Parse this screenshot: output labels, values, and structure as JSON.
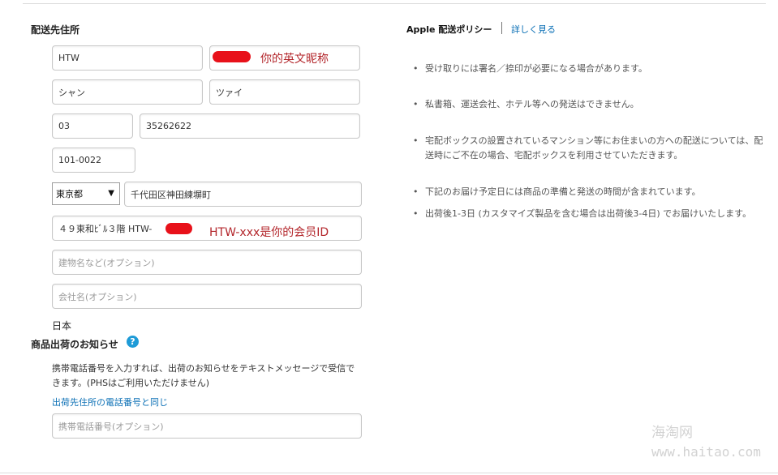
{
  "shipping": {
    "heading": "配送先住所",
    "first_name": "HTW",
    "nickname_annotation": "你的英文昵称",
    "last_name_kana": "シャン",
    "first_name_kana": "ツァイ",
    "area_code": "03",
    "phone": "35262622",
    "postal_code": "101-0022",
    "prefecture": "東京都",
    "city": "千代田区神田練塀町",
    "street": "４９東和ﾋﾞﾙ３階 HTW-",
    "member_id_annotation": "HTW-xxx是你的会员ID",
    "building_placeholder": "建物名など(オプション)",
    "company_placeholder": "会社名(オプション)",
    "country": "日本"
  },
  "notification": {
    "heading": "商品出荷のお知らせ",
    "help_icon": "?",
    "description_line1": "携帯電話番号を入力すれば、出荷のお知らせをテキストメッセージで受信で",
    "description_line2": "きます。(PHSはご利用いただけません)",
    "same_phone_link": "出荷先住所の電話番号と同じ",
    "mobile_placeholder": "携帯電話番号(オプション)"
  },
  "policy": {
    "title": "Apple 配送ポリシー",
    "more_link": "詳しく見る",
    "bullets": [
      "受け取りには署名／捺印が必要になる場合があります。",
      "私書箱、運送会社、ホテル等への発送はできません。",
      "宅配ボックスの設置されているマンション等にお住まいの方への配送については、配",
      "送時にご不在の場合、宅配ボックスを利用させていただきます。",
      "下記のお届け予定日には商品の準備と発送の時間が含まれています。",
      "出荷後1-3日 (カスタマイズ製品を含む場合は出荷後3-4日) でお届けいたします。"
    ]
  },
  "watermark": {
    "line1": "海淘网",
    "line2": "www.haitao.com"
  },
  "colors": {
    "link": "#0a6fb5",
    "annotation": "#b3262b",
    "redaction": "#e8111a",
    "help_icon": "#1e9bd7"
  }
}
